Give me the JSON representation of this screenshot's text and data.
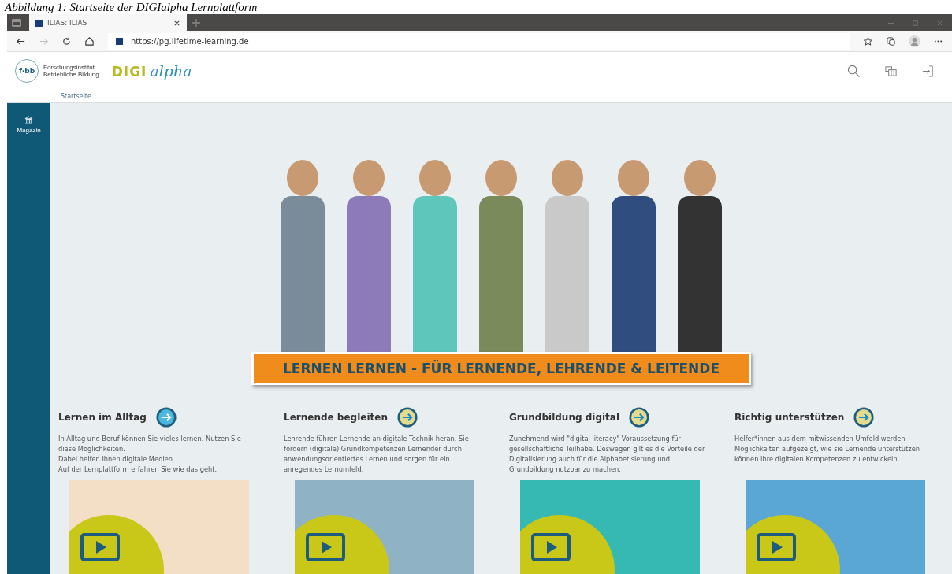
{
  "caption": "Abbildung 1: Startseite der DIGIalpha Lernplattform",
  "browser": {
    "tab": {
      "title": "ILIAS: ILIAS",
      "selected": true
    },
    "url": "https://pg.lifetime-learning.de"
  },
  "header": {
    "logo_text_1": "Forschungsinstitut",
    "logo_text_2": "Betriebliche Bildung",
    "logo_mark": "f·bb",
    "brand_1": "DIGI",
    "brand_2": "alpha",
    "breadcrumb": "Startseite"
  },
  "sidebar": {
    "items": [
      {
        "label": "Magazin"
      }
    ]
  },
  "banner": "LERNEN LERNEN - FÜR LERNENDE, LEHRENDE & LEITENDE",
  "cards": [
    {
      "title": "Lernen im Alltag",
      "color": "#4bb7df",
      "lines": [
        "In Alltag und Beruf können Sie vieles lernen. Nutzen Sie diese Möglichkeiten.",
        "Dabei helfen Ihnen digitale Medien.",
        "Auf der Lernplattform erfahren Sie wie das geht."
      ]
    },
    {
      "title": "Lernende begleiten",
      "color": "#e3dc8e",
      "lines": [
        "Lehrende führen Lernende an digitale Technik heran. Sie fördern (digitale) Grundkompetenzen Lernender durch anwendungsorientiertes Lernen und sorgen für ein anregendes Lernumfeld."
      ]
    },
    {
      "title": "Grundbildung digital",
      "color": "#e3dc8e",
      "lines": [
        "Zunehmend wird \"digital literacy\" Voraussetzung für gesellschaftliche Teilhabe. Deswegen gilt es die Vorteile der Digitalisierung auch für die Alphabetisierung und Grundbildung nutzbar zu machen."
      ]
    },
    {
      "title": "Richtig unterstützen",
      "color": "#e3dc8e",
      "lines": [
        "Helfer*innen aus dem mitwissenden Umfeld werden Möglichkeiten aufgezeigt, wie sie Lernende unterstützen können ihre digitalen Kompetenzen zu entwickeln."
      ]
    }
  ]
}
